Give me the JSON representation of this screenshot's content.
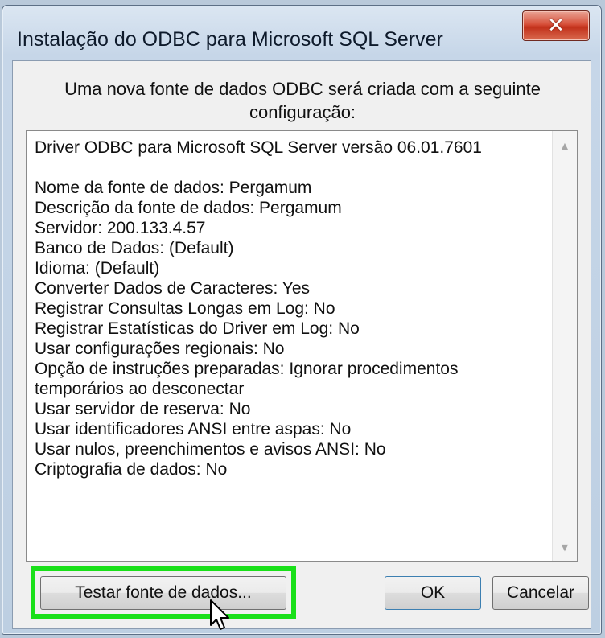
{
  "window": {
    "title": "Instalação do ODBC para Microsoft SQL Server",
    "close_icon": "close-icon"
  },
  "intro_text": "Uma nova fonte de dados ODBC será criada com a seguinte configuração:",
  "configuration": {
    "driver_line": "Driver ODBC para Microsoft SQL Server versão 06.01.7601",
    "lines": [
      "Nome da fonte de dados: Pergamum",
      "Descrição da fonte de dados: Pergamum",
      "Servidor: 200.133.4.57",
      "Banco de Dados: (Default)",
      "Idioma: (Default)",
      "Converter Dados de Caracteres: Yes",
      "Registrar Consultas Longas em Log: No",
      "Registrar Estatísticas do Driver em Log: No",
      "Usar configurações regionais: No",
      "Opção de instruções preparadas: Ignorar procedimentos",
      "temporários ao desconectar",
      "Usar servidor de reserva: No",
      "Usar identificadores ANSI entre aspas: No",
      "Usar nulos, preenchimentos e avisos ANSI: No",
      "Criptografia de dados: No"
    ]
  },
  "buttons": {
    "test_label": "Testar fonte de dados...",
    "ok_label": "OK",
    "cancel_label": "Cancelar"
  },
  "colors": {
    "highlight": "#19e019",
    "close_button": "#c2311b"
  },
  "icons": {
    "scroll_up": "scroll-up-arrow-icon",
    "scroll_down": "scroll-down-arrow-icon",
    "cursor": "mouse-pointer-icon"
  }
}
